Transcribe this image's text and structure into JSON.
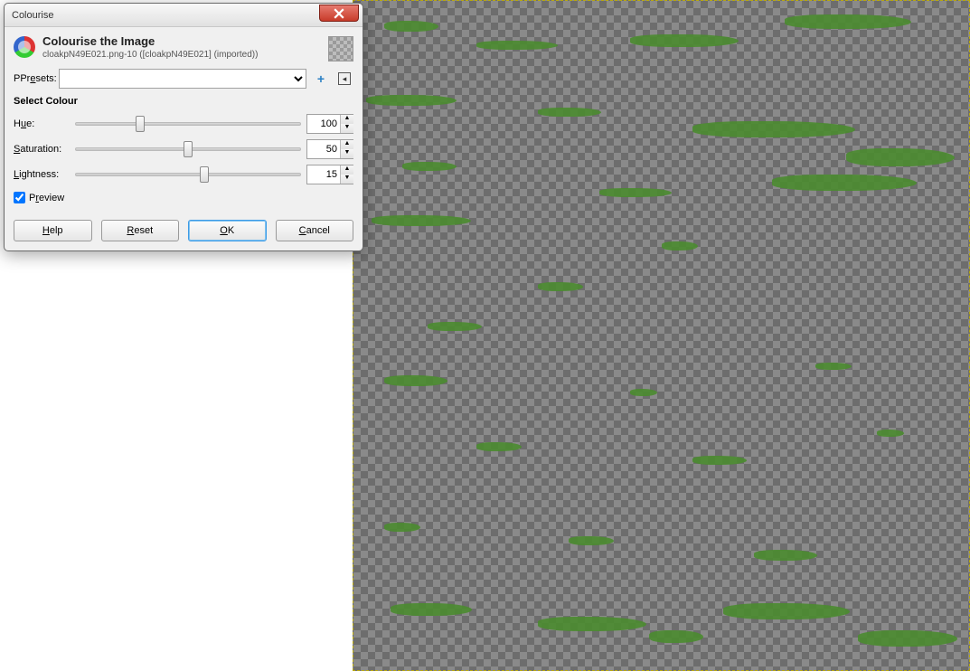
{
  "dialog": {
    "window_title": "Colourise",
    "header_title": "Colourise the Image",
    "header_sub": "cloakpN49E021.png-10 ([cloakpN49E021] (imported))",
    "presets_label": "Presets:",
    "presets_selected": "",
    "section_label": "Select Colour",
    "sliders": {
      "hue": {
        "label_pre": "H",
        "label_u": "u",
        "label_post": "e:",
        "value": 100,
        "min": 0,
        "max": 360
      },
      "saturation": {
        "label_pre": "",
        "label_u": "S",
        "label_post": "aturation:",
        "value": 50,
        "min": 0,
        "max": 100
      },
      "lightness": {
        "label_pre": "",
        "label_u": "L",
        "label_post": "ightness:",
        "value": 15,
        "min": -100,
        "max": 100
      }
    },
    "preview_label_pre": "P",
    "preview_label_u": "r",
    "preview_label_post": "eview",
    "preview_checked": true,
    "buttons": {
      "help": {
        "pre": "",
        "u": "H",
        "post": "elp"
      },
      "reset": {
        "pre": "",
        "u": "R",
        "post": "eset"
      },
      "ok": {
        "pre": "",
        "u": "O",
        "post": "K"
      },
      "cancel": {
        "pre": "",
        "u": "C",
        "post": "ancel"
      }
    }
  }
}
